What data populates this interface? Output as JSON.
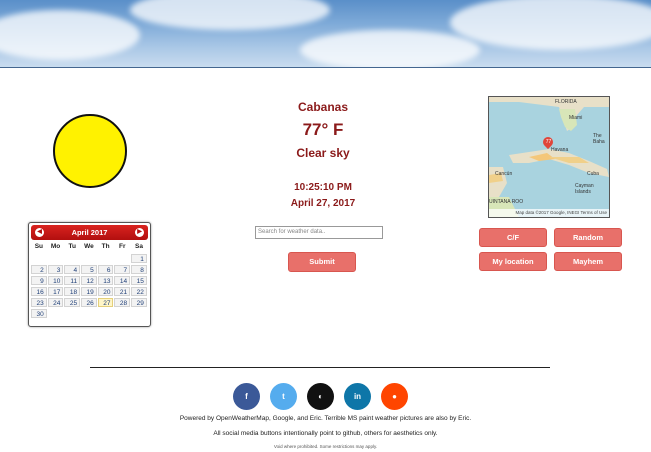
{
  "weather": {
    "city": "Cabanas",
    "temperature": "77° F",
    "description": "Clear sky",
    "time": "10:25:10 PM",
    "date": "April 27, 2017"
  },
  "calendar": {
    "month_label": "April 2017",
    "weekdays": [
      "Su",
      "Mo",
      "Tu",
      "We",
      "Th",
      "Fr",
      "Sa"
    ],
    "days": [
      "1",
      "2",
      "3",
      "4",
      "5",
      "6",
      "7",
      "8",
      "9",
      "10",
      "11",
      "12",
      "13",
      "14",
      "15",
      "16",
      "17",
      "18",
      "19",
      "20",
      "21",
      "22",
      "23",
      "24",
      "25",
      "26",
      "27",
      "28",
      "29",
      "30"
    ],
    "today": "27",
    "prev_icon": "chevron-left-icon",
    "next_icon": "chevron-right-icon"
  },
  "search": {
    "placeholder": "Search for weather data..",
    "submit_label": "Submit"
  },
  "buttons": {
    "cf": "C/F",
    "random": "Random",
    "my_location": "My location",
    "mayhem": "Mayhem"
  },
  "map": {
    "labels": [
      "FLORIDA",
      "Miami",
      "The Baha",
      "Havana",
      "Cuba",
      "Cancún",
      "Cayman Islands",
      "UINTANA ROO"
    ],
    "marker_value": "77",
    "footer": "Map data ©2017 Google, INEGI   Terms of Use"
  },
  "social": [
    {
      "icon": "facebook-icon",
      "glyph": "f",
      "color": "#3b5998"
    },
    {
      "icon": "twitter-icon",
      "glyph": "t",
      "color": "#55acee"
    },
    {
      "icon": "github-icon",
      "glyph": "◐",
      "color": "#111111"
    },
    {
      "icon": "linkedin-icon",
      "glyph": "in",
      "color": "#0e76a8"
    },
    {
      "icon": "reddit-icon",
      "glyph": "●",
      "color": "#ff4500"
    }
  ],
  "footer": {
    "line1": "Powered by OpenWeatherMap, Google, and Eric. Terrible MS paint weather pictures are also by Eric.",
    "line2": "All social media buttons intentionally point to github, others for aesthetics only.",
    "line3": "Void where prohibited. Some restrictions may apply."
  },
  "colors": {
    "accent": "#8b1a1a",
    "button": "#e8706a",
    "calendar_header": "#c8171a",
    "sun": "#fff200"
  }
}
